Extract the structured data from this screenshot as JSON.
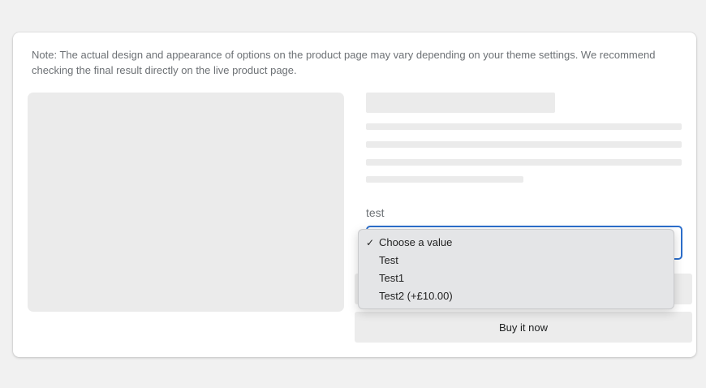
{
  "note": "Note: The actual design and appearance of options on the product page may vary depending on your theme settings. We recommend checking the final result directly on the live product page.",
  "option": {
    "label": "test",
    "selected": "Choose a value",
    "options": [
      {
        "label": "Choose a value",
        "selected": true
      },
      {
        "label": "Test",
        "selected": false
      },
      {
        "label": "Test1",
        "selected": false
      },
      {
        "label": "Test2 (+£10.00)",
        "selected": false
      }
    ]
  },
  "buttons": {
    "add_to_cart": "",
    "buy_now": "Buy it now"
  },
  "icons": {
    "check": "checkmark-icon"
  },
  "colors": {
    "focus_border": "#2c6ecb",
    "skeleton": "#ebebeb"
  }
}
